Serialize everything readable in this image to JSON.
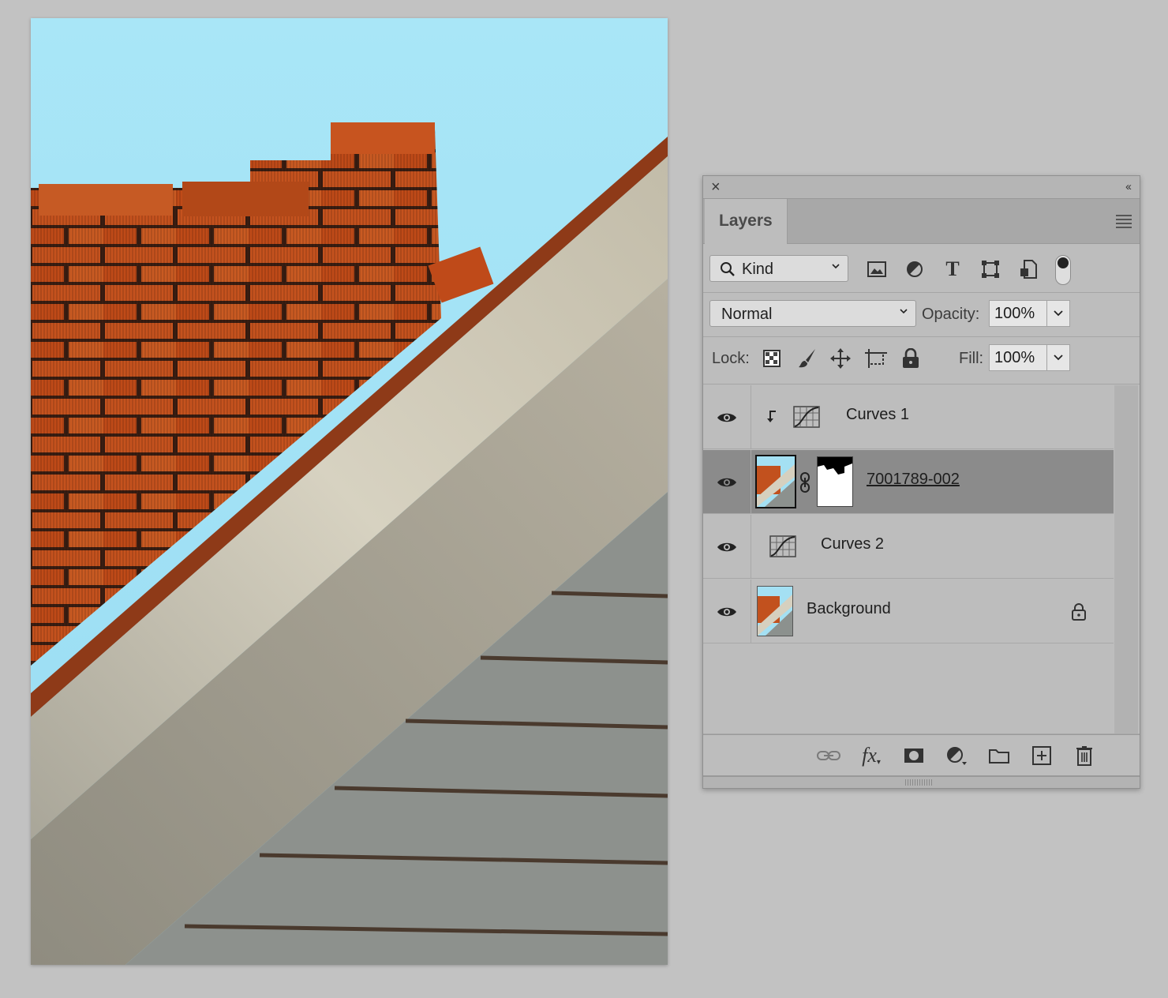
{
  "panel": {
    "tab": "Layers",
    "filter": {
      "kind_label": "Kind"
    },
    "blend": {
      "mode": "Normal",
      "opacity_label": "Opacity:",
      "opacity_value": "100%"
    },
    "lock": {
      "label": "Lock:",
      "fill_label": "Fill:",
      "fill_value": "100%"
    },
    "layers": [
      {
        "name": "Curves 1",
        "type": "adjustment-clipped",
        "visible": true
      },
      {
        "name": "7001789-002",
        "type": "image-with-mask",
        "visible": true,
        "selected": true
      },
      {
        "name": "Curves 2",
        "type": "adjustment",
        "visible": true
      },
      {
        "name": "Background",
        "type": "image-locked",
        "visible": true
      }
    ],
    "bottom_icons": [
      "link-icon",
      "fx-icon",
      "mask-icon",
      "adjustment-icon",
      "folder-icon",
      "new-layer-icon",
      "trash-icon"
    ]
  },
  "filter_icons": [
    "image-filter-icon",
    "adjustment-filter-icon",
    "type-filter-icon",
    "shape-filter-icon",
    "smart-object-filter-icon"
  ],
  "colors": {
    "sky": "#a6e3f5",
    "brick": "#c4511f",
    "wood": "#cfc8b4",
    "siding": "#8e9490",
    "panel_bg": "#bdbdbd",
    "selected_row": "#8b8b8b"
  }
}
